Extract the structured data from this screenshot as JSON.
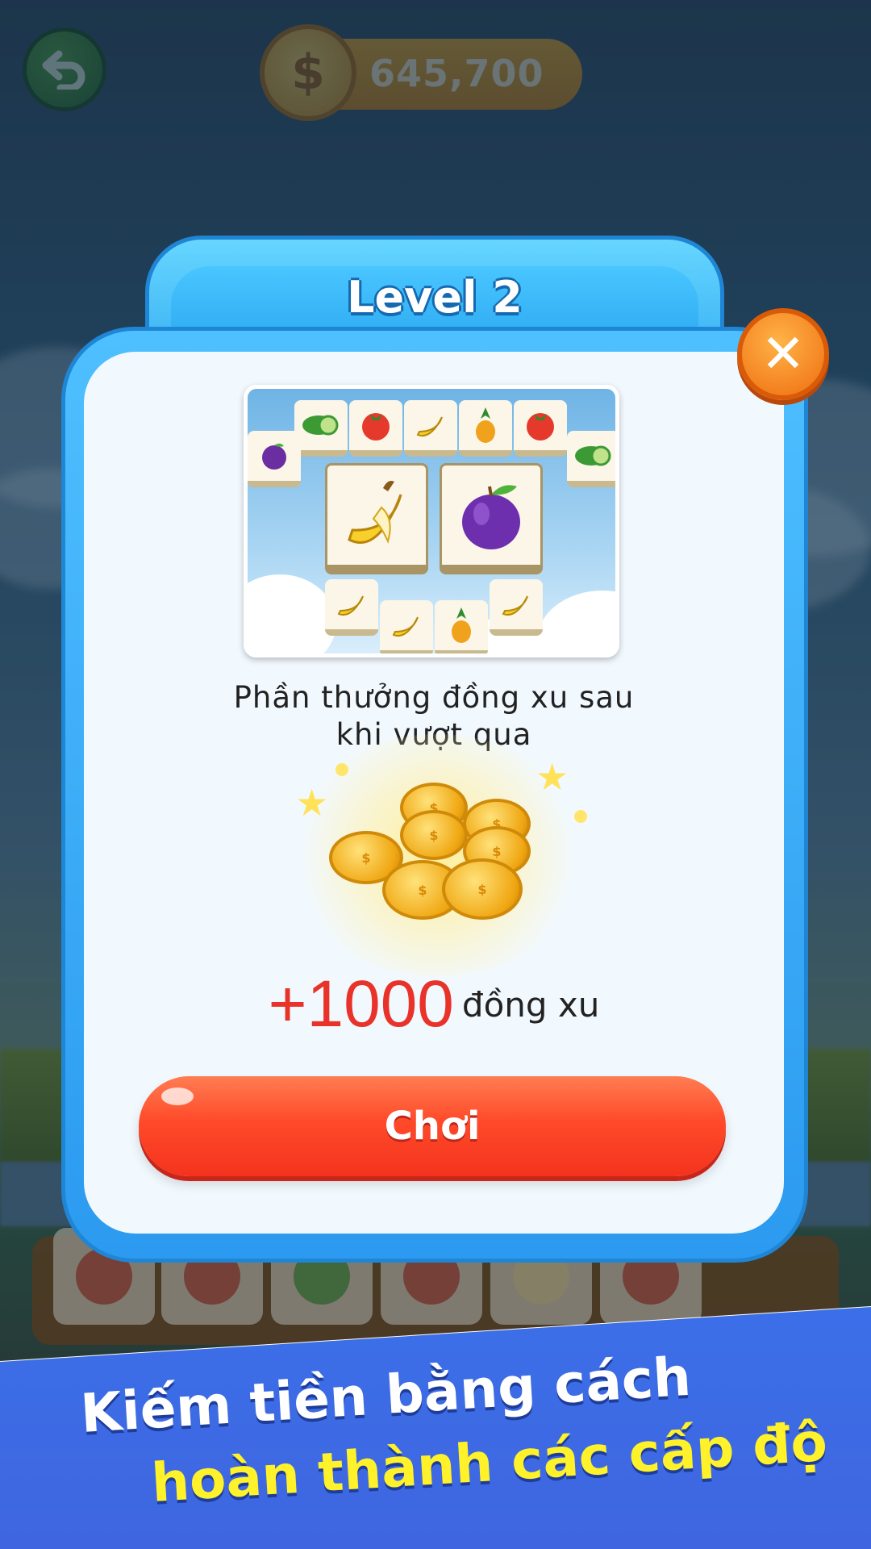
{
  "top_bar": {
    "coin_balance": "645,700",
    "coin_symbol": "$"
  },
  "dialog": {
    "title": "Level 2",
    "reward_text_line1": "Phần thưởng đồng xu sau",
    "reward_text_line2": "khi vượt qua",
    "reward_amount": "+1000",
    "reward_unit": "đồng xu",
    "play_button_label": "Chơi",
    "close_symbol": "✕"
  },
  "banner": {
    "line1": "Kiếm tiền bằng cách",
    "line2": "hoàn thành các cấp độ"
  },
  "preview": {
    "tiles_top_row": [
      "cucumber",
      "tomato",
      "banana",
      "pineapple",
      "tomato"
    ],
    "featured_tiles": [
      "banana",
      "plum"
    ]
  },
  "colors": {
    "dialog_blue": "#2b9af0",
    "play_button": "#ff4a2a",
    "reward_red": "#e8322a",
    "banner_blue": "#3b6fe8",
    "banner_yellow": "#fff22a"
  }
}
